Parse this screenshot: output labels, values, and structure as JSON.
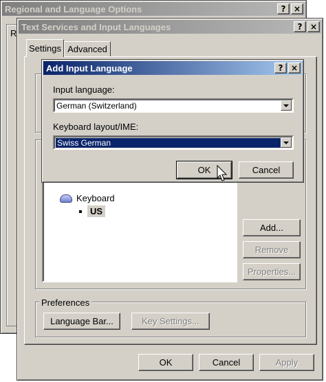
{
  "regional_window": {
    "title": "Regional and Language Options",
    "help": "?",
    "close": "×",
    "left_tab_partial": "R"
  },
  "tsil_window": {
    "title": "Text Services and Input Languages",
    "help": "?",
    "close": "×",
    "tabs": [
      "Settings",
      "Advanced"
    ],
    "installed": {
      "service_group": "Keyboard",
      "service_item": "US"
    },
    "side_buttons": {
      "add": "Add...",
      "remove": "Remove",
      "properties": "Properties..."
    },
    "preferences": {
      "label": "Preferences",
      "language_bar": "Language Bar...",
      "key_settings": "Key Settings..."
    },
    "footer": {
      "ok": "OK",
      "cancel": "Cancel",
      "apply": "Apply"
    }
  },
  "add_dialog": {
    "title": "Add Input Language",
    "help": "?",
    "close": "×",
    "input_language_label": "Input language:",
    "input_language_value": "German (Switzerland)",
    "keyboard_layout_label": "Keyboard layout/IME:",
    "keyboard_layout_value": "Swiss German",
    "ok": "OK",
    "cancel": "Cancel"
  }
}
